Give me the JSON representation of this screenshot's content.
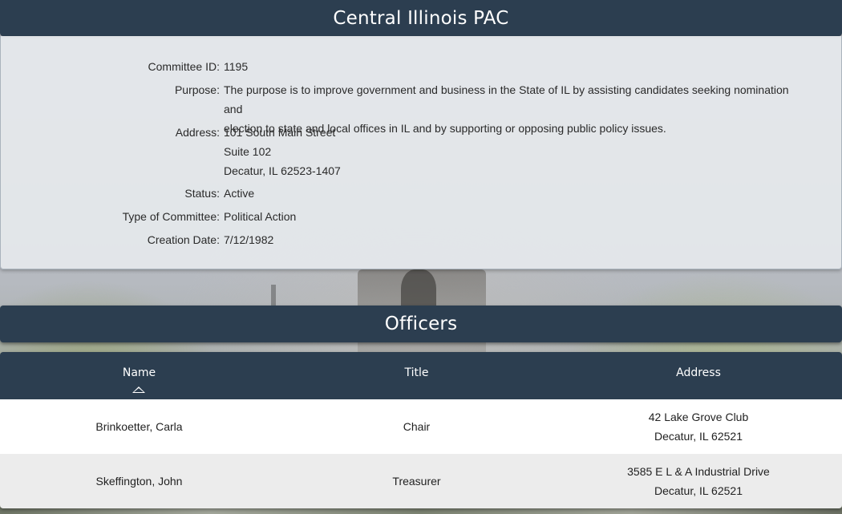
{
  "committee": {
    "name": "Central Illinois PAC",
    "fields": {
      "id_label": "Committee ID:",
      "id_value": "1195",
      "purpose_label": "Purpose:",
      "purpose_line1": "The purpose is to improve government and business in the State of IL by assisting candidates seeking nomination and",
      "purpose_line2": "election to state and local offices in IL and by supporting or opposing public policy issues.",
      "address_label": "Address:",
      "address_line1": "101 South Main Street",
      "address_line2": "Suite 102",
      "address_line3": "Decatur, IL 62523-1407",
      "status_label": "Status:",
      "status_value": "Active",
      "type_label": "Type of Committee:",
      "type_value": "Political Action",
      "date_label": "Creation Date:",
      "date_value": "7/12/1982"
    }
  },
  "officers": {
    "heading": "Officers",
    "columns": {
      "name": "Name",
      "title": "Title",
      "address": "Address"
    },
    "sort": "name-ascending",
    "rows": [
      {
        "name": "Brinkoetter, Carla",
        "title": "Chair",
        "address_line1": "42 Lake Grove Club",
        "address_line2": "Decatur, IL 62521"
      },
      {
        "name": "Skeffington, John",
        "title": "Treasurer",
        "address_line1": "3585 E L & A Industrial Drive",
        "address_line2": "Decatur, IL 62521"
      }
    ]
  },
  "colors": {
    "header_bg": "#2c3e50",
    "panel_bg": "#e5e8ec",
    "row_alt_bg": "#ececec"
  }
}
